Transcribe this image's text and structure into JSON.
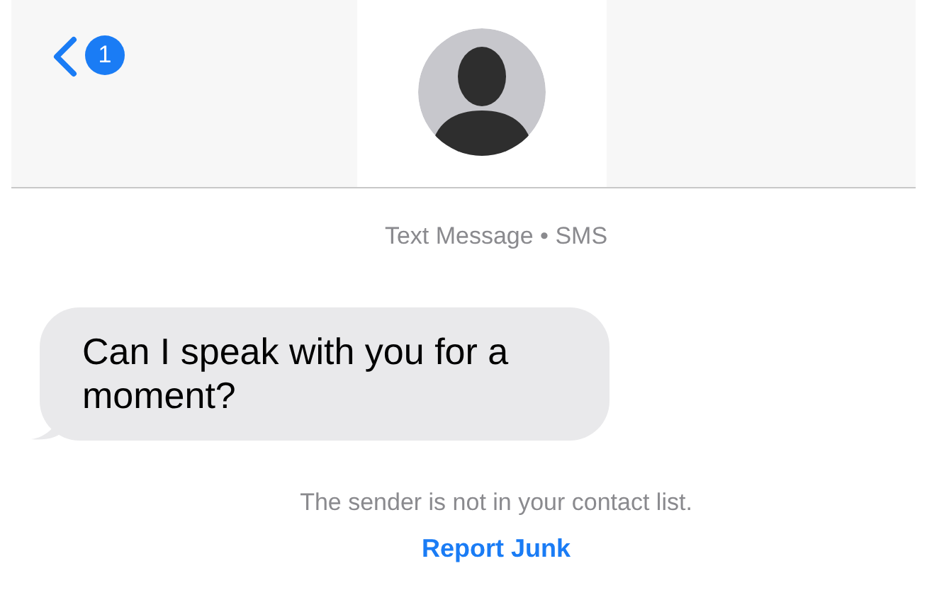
{
  "header": {
    "unread_count": "1"
  },
  "conversation": {
    "service_label": "Text Message • SMS",
    "messages": [
      {
        "kind": "incoming",
        "text": "Can I speak with you for a moment?"
      }
    ],
    "notice": "The sender is not in your contact list.",
    "action_link": "Report Junk"
  }
}
